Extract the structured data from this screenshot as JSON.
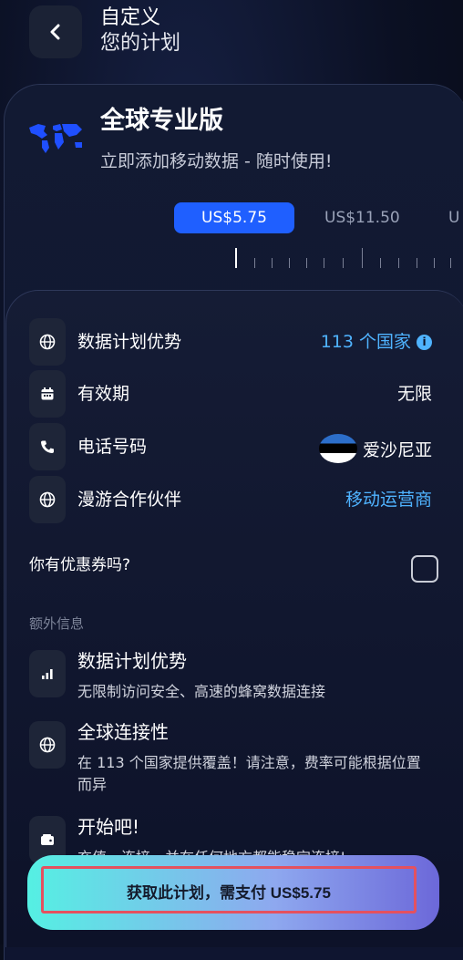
{
  "header": {
    "title": "自定义",
    "subtitle": "您的计划"
  },
  "plan": {
    "name": "全球专业版",
    "description": "立即添加移动数据 - 随时使用!",
    "prices": [
      "US$5.75",
      "US$11.50",
      "U"
    ],
    "selected_index": 0
  },
  "details": [
    {
      "icon": "globe-icon",
      "label": "数据计划优势",
      "value": "113 个国家",
      "value_style": "link",
      "has_info": true
    },
    {
      "icon": "calendar-icon",
      "label": "有效期",
      "value": "无限"
    },
    {
      "icon": "phone-icon",
      "label": "电话号码",
      "value": "爱沙尼亚",
      "flag": "estonia-flag"
    },
    {
      "icon": "globe-icon",
      "label": "漫游合作伙伴",
      "value": "移动运营商",
      "value_style": "link"
    }
  ],
  "coupon": {
    "question": "你有优惠券吗?",
    "checked": false
  },
  "extra": {
    "title": "额外信息",
    "items": [
      {
        "icon": "signal-bars-icon",
        "title": "数据计划优势",
        "desc": "无限制访问安全、高速的蜂窝数据连接"
      },
      {
        "icon": "globe-icon",
        "title": "全球连接性",
        "desc": "在 113 个国家提供覆盖！请注意，费率可能根据位置而异"
      },
      {
        "icon": "wallet-icon",
        "title": "开始吧!",
        "desc": "充值、连接，并在任何地方都能稳定连接!"
      }
    ]
  },
  "cta": {
    "label": "获取此计划，需支付 US$5.75"
  },
  "colors": {
    "accent": "#1f5fff",
    "link": "#4fb3ff",
    "cta_start": "#55f0e3",
    "cta_end": "#6c68d9"
  }
}
